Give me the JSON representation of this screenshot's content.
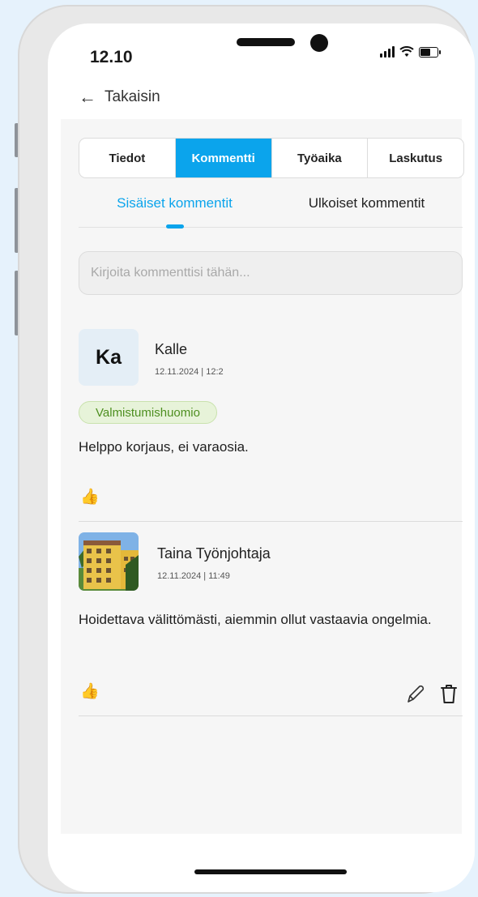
{
  "status": {
    "time": "12.10"
  },
  "nav": {
    "back_label": "Takaisin"
  },
  "tabs": [
    {
      "label": "Tiedot",
      "active": false
    },
    {
      "label": "Kommentti",
      "active": true
    },
    {
      "label": "Työaika",
      "active": false
    },
    {
      "label": "Laskutus",
      "active": false
    }
  ],
  "subtabs": [
    {
      "label": "Sisäiset kommentit",
      "active": true
    },
    {
      "label": "Ulkoiset kommentit",
      "active": false
    }
  ],
  "comment_input": {
    "placeholder": "Kirjoita kommenttisi tähän...",
    "value": ""
  },
  "comments": [
    {
      "avatar_initials": "Ka",
      "author": "Kalle",
      "timestamp": "12.11.2024 | 12:2",
      "badge": "Valmistumishuomio",
      "text": "Helppo korjaus, ei varaosia.",
      "reaction_icon": "thumbs-up-icon"
    },
    {
      "avatar_image": "building-photo",
      "author": "Taina Työnjohtaja",
      "timestamp": "12.11.2024 | 11:49",
      "text": "Hoidettava välittömästi, aiemmin ollut vastaavia ongelmia.",
      "reaction_icon": "thumbs-up-icon",
      "actions": [
        "edit-icon",
        "delete-icon"
      ]
    }
  ],
  "colors": {
    "accent": "#0ba4ec",
    "badge_bg": "#e7f3d9",
    "badge_text": "#4e8f20",
    "background": "#e6f2fc"
  }
}
